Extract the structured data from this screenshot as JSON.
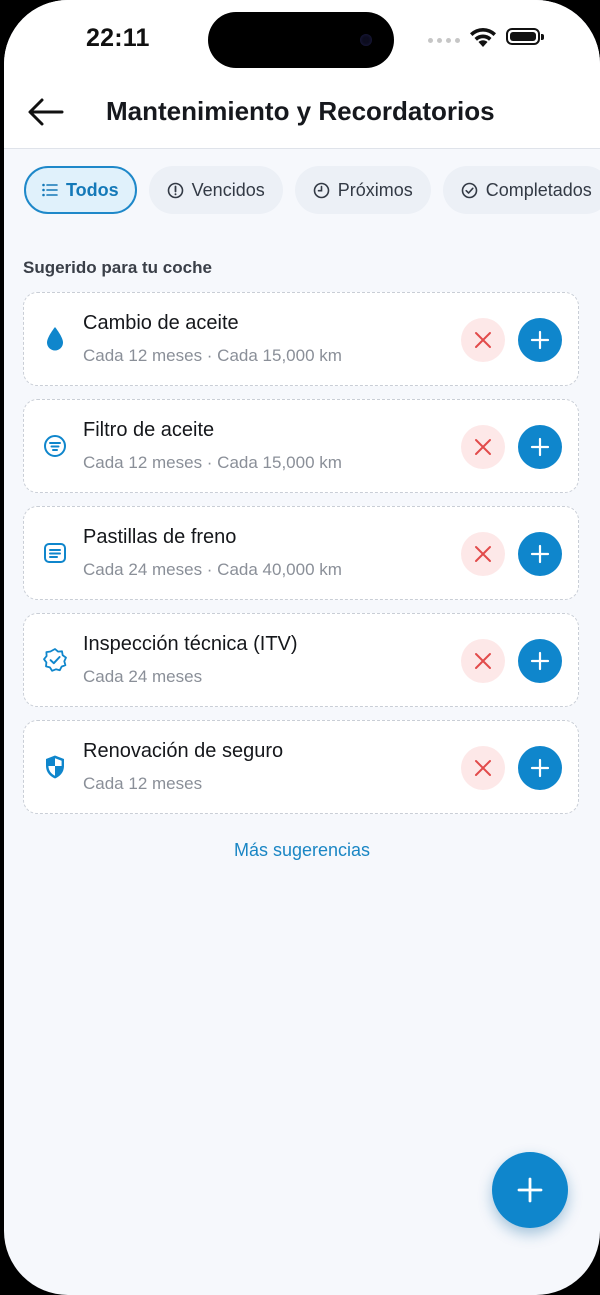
{
  "status_bar": {
    "time": "22:11"
  },
  "header": {
    "title": "Mantenimiento y Recordatorios"
  },
  "filters": [
    {
      "label": "Todos",
      "icon": "list-icon",
      "active": true
    },
    {
      "label": "Vencidos",
      "icon": "alert-circle-icon",
      "active": false
    },
    {
      "label": "Próximos",
      "icon": "clock-icon",
      "active": false
    },
    {
      "label": "Completados",
      "icon": "check-circle-icon",
      "active": false
    }
  ],
  "section": {
    "title": "Sugerido para tu coche"
  },
  "suggestions": [
    {
      "title": "Cambio de aceite",
      "subtitle": "Cada 12 meses · Cada 15,000 km",
      "icon": "oil-drop-icon"
    },
    {
      "title": "Filtro de aceite",
      "subtitle": "Cada 12 meses · Cada 15,000 km",
      "icon": "filter-icon"
    },
    {
      "title": "Pastillas de freno",
      "subtitle": "Cada 24 meses · Cada 40,000 km",
      "icon": "brake-pad-icon"
    },
    {
      "title": "Inspección técnica (ITV)",
      "subtitle": "Cada 24 meses",
      "icon": "verified-badge-icon"
    },
    {
      "title": "Renovación de seguro",
      "subtitle": "Cada 12 meses",
      "icon": "shield-icon"
    }
  ],
  "more_link": "Más sugerencias",
  "colors": {
    "accent": "#0f86cc",
    "dismiss_bg": "#fde8e8",
    "dismiss_icon": "#e24b4b",
    "background": "#f6f8fc"
  }
}
